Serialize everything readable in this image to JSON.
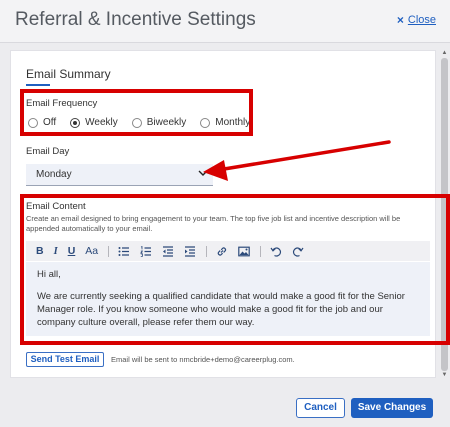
{
  "header": {
    "title": "Referral & Incentive Settings",
    "close_symbol": "×",
    "close_label": "Close"
  },
  "email_summary": {
    "heading": "Email Summary",
    "frequency": {
      "label": "Email Frequency",
      "options": [
        {
          "label": "Off",
          "checked": false
        },
        {
          "label": "Weekly",
          "checked": true
        },
        {
          "label": "Biweekly",
          "checked": false
        },
        {
          "label": "Monthly",
          "checked": false
        }
      ]
    },
    "day": {
      "label": "Email Day",
      "value": "Monday"
    },
    "content": {
      "label": "Email Content",
      "helper": "Create an email designed to bring engagement to your team. The top five job list and incentive description will be appended automatically to your email.",
      "paragraphs": [
        "Hi all,",
        "We are currently seeking a qualified candidate that would make a good fit for the Senior Manager role. If you know someone who would make a good fit for the job and our company culture overall, please refer them our way."
      ]
    },
    "toolbar": {
      "bold": "B",
      "italic": "I",
      "underline": "U",
      "font_size": "Aa",
      "icons": [
        "bulleted-list-icon",
        "numbered-list-icon",
        "outdent-icon",
        "indent-icon",
        "link-icon",
        "image-icon",
        "undo-icon",
        "redo-icon"
      ]
    },
    "test_email": {
      "button_label": "Send Test Email",
      "note": "Email will be sent to nmcbride+demo@careerplug.com."
    }
  },
  "footer": {
    "cancel_label": "Cancel",
    "save_label": "Save Changes"
  },
  "colors": {
    "accent": "#1f5fc0",
    "highlight": "#d70000"
  }
}
